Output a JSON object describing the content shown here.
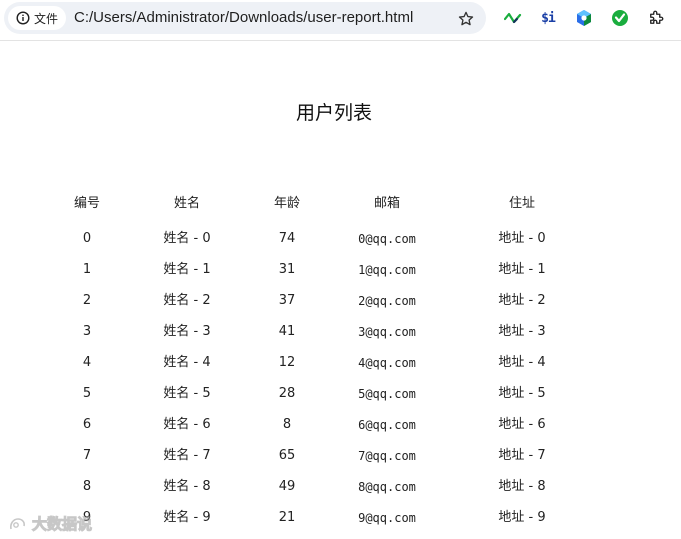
{
  "toolbar": {
    "site_chip_label": "文件",
    "url": "C:/Users/Administrator/Downloads/user-report.html",
    "extensions": {
      "si_label": "$i"
    }
  },
  "page": {
    "title": "用户列表",
    "table": {
      "headers": [
        "编号",
        "姓名",
        "年龄",
        "邮箱",
        "住址"
      ],
      "rows": [
        [
          "0",
          "姓名 - 0",
          "74",
          "0@qq.com",
          "地址 - 0"
        ],
        [
          "1",
          "姓名 - 1",
          "31",
          "1@qq.com",
          "地址 - 1"
        ],
        [
          "2",
          "姓名 - 2",
          "37",
          "2@qq.com",
          "地址 - 2"
        ],
        [
          "3",
          "姓名 - 3",
          "41",
          "3@qq.com",
          "地址 - 3"
        ],
        [
          "4",
          "姓名 - 4",
          "12",
          "4@qq.com",
          "地址 - 4"
        ],
        [
          "5",
          "姓名 - 5",
          "28",
          "5@qq.com",
          "地址 - 5"
        ],
        [
          "6",
          "姓名 - 6",
          "8",
          "6@qq.com",
          "地址 - 6"
        ],
        [
          "7",
          "姓名 - 7",
          "65",
          "7@qq.com",
          "地址 - 7"
        ],
        [
          "8",
          "姓名 - 8",
          "49",
          "8@qq.com",
          "地址 - 8"
        ],
        [
          "9",
          "姓名 - 9",
          "21",
          "9@qq.com",
          "地址 - 9"
        ]
      ]
    }
  },
  "watermark": {
    "text": "大数据说"
  },
  "colors": {
    "omnibox_bg": "#eef1f6",
    "text": "#1f1f1f",
    "ext_green": "#1aad3e",
    "ext_blue": "#1a3fa6"
  }
}
